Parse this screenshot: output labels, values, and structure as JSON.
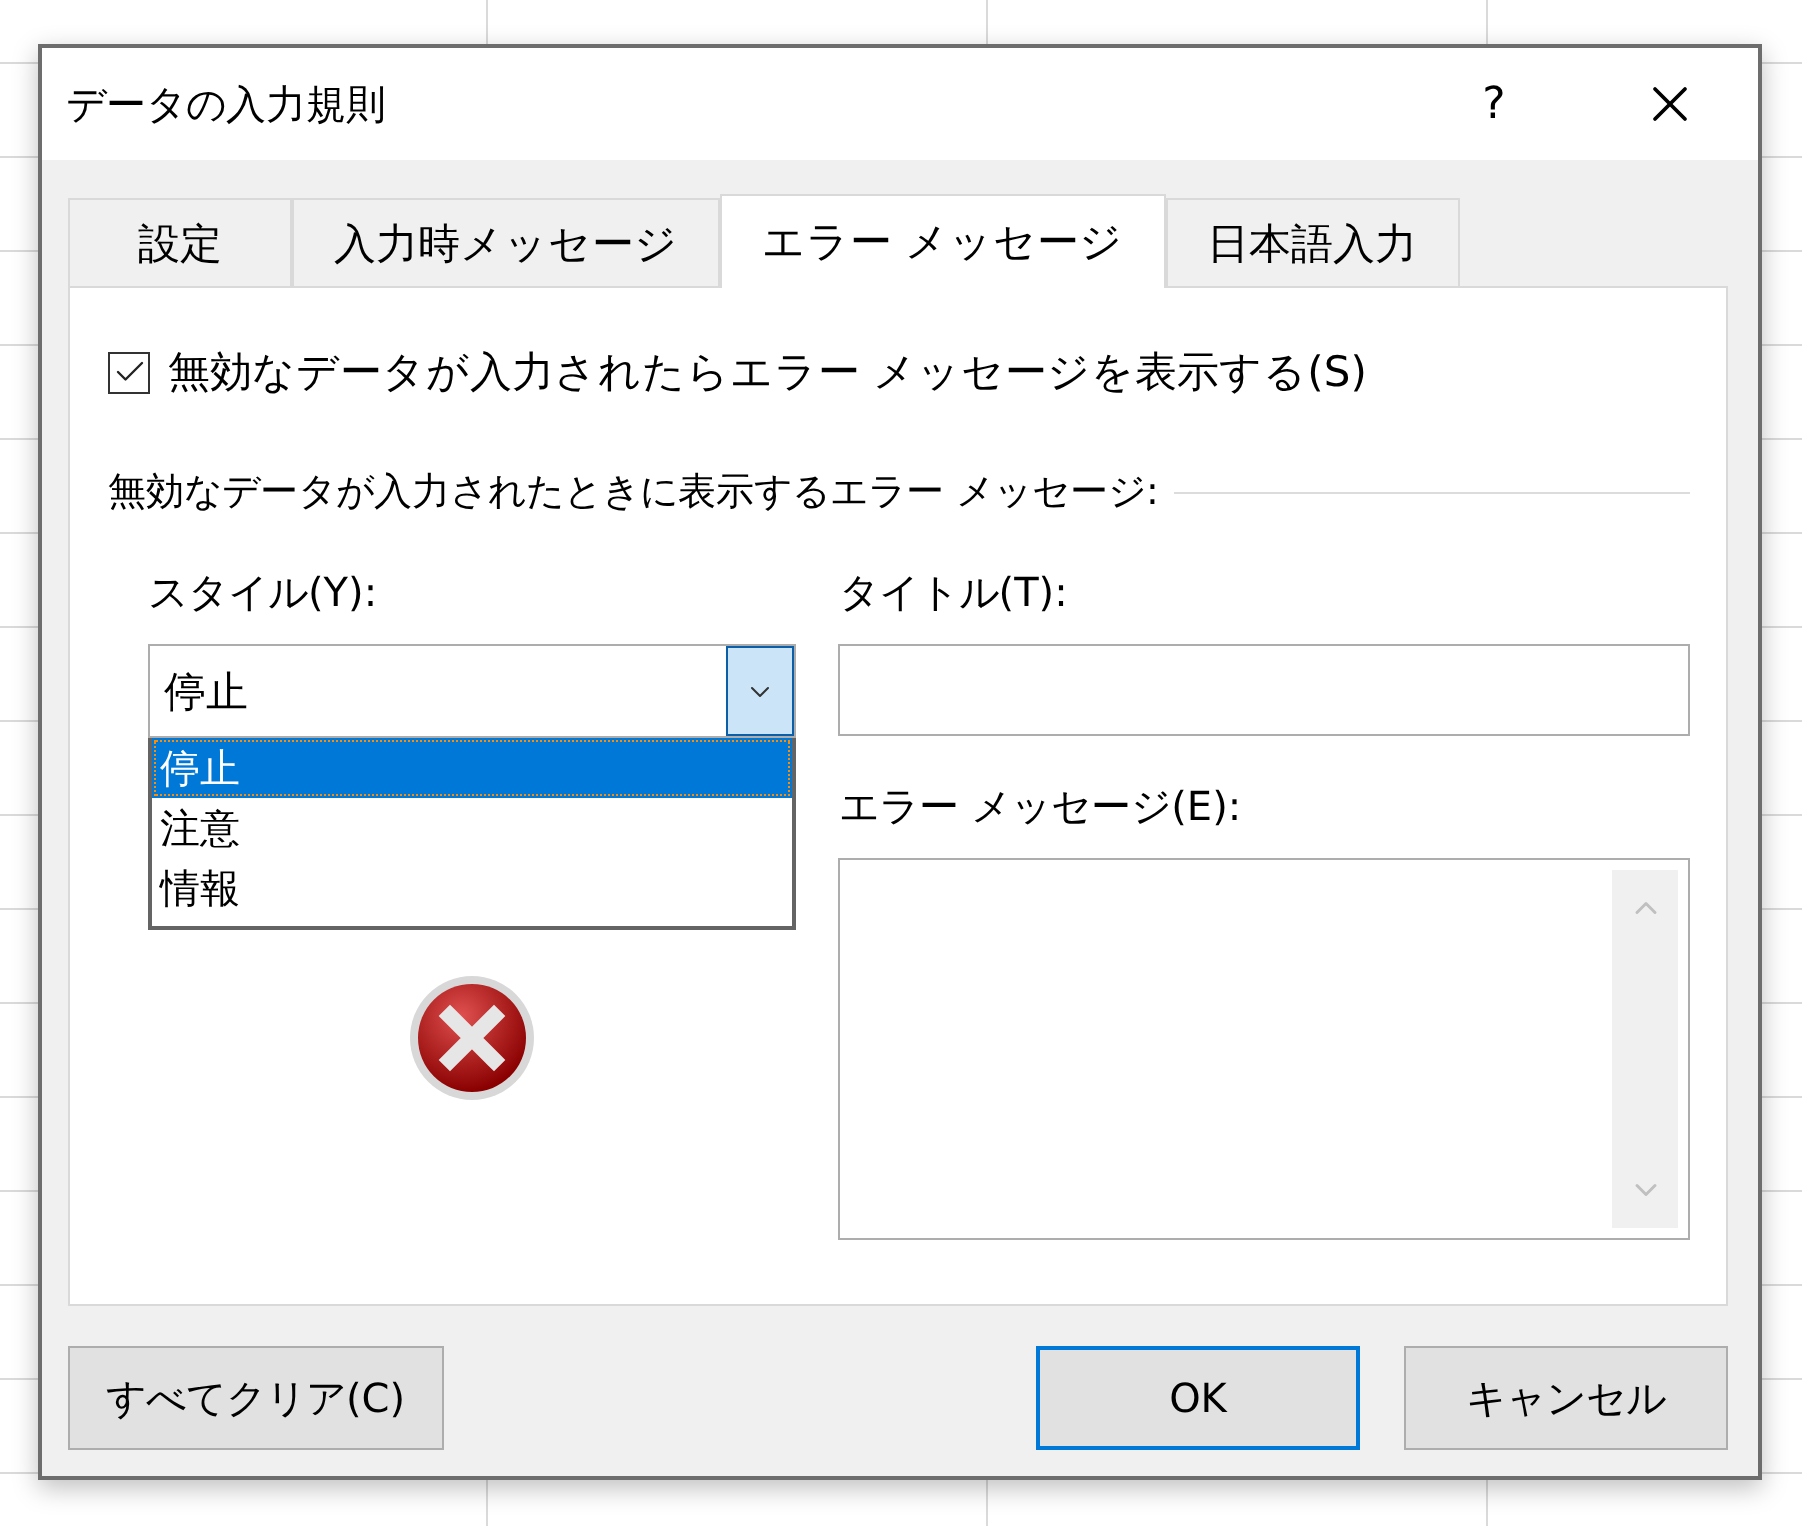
{
  "window": {
    "title": "データの入力規則",
    "help": "?"
  },
  "tabs": [
    {
      "label": "設定",
      "selected": false
    },
    {
      "label": "入力時メッセージ",
      "selected": false
    },
    {
      "label": "エラー メッセージ",
      "selected": true
    },
    {
      "label": "日本語入力",
      "selected": false
    }
  ],
  "show_error": {
    "label": "無効なデータが入力されたらエラー メッセージを表示する(S)",
    "checked": true
  },
  "section_label": "無効なデータが入力されたときに表示するエラー メッセージ:",
  "style": {
    "label": "スタイル(Y):",
    "value": "停止",
    "expanded": true,
    "options": [
      {
        "label": "停止",
        "selected": true
      },
      {
        "label": "注意",
        "selected": false
      },
      {
        "label": "情報",
        "selected": false
      }
    ]
  },
  "title_field": {
    "label": "タイトル(T):"
  },
  "message_field": {
    "label": "エラー メッセージ(E):"
  },
  "buttons": [
    {
      "label": "すべてクリア(C)",
      "default": false
    },
    {
      "label": "OK",
      "default": true
    },
    {
      "label": "キャンセル",
      "default": false
    }
  ]
}
